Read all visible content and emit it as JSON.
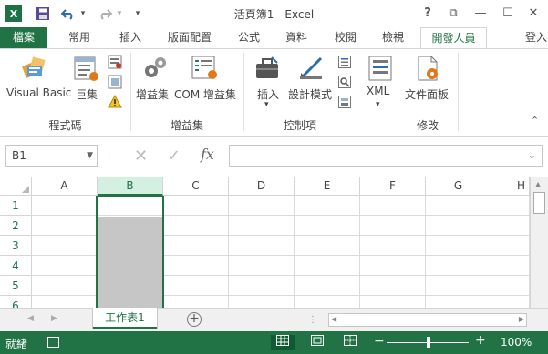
{
  "app": {
    "title": "活頁簿1 - Excel",
    "logo_letter": "X",
    "colors": {
      "accent": "#217346",
      "status_bar": "#217346",
      "selection": "#c6c6c6",
      "header_highlight": "#d3f0e0"
    }
  },
  "quick_access": {
    "icons": [
      "save-icon",
      "undo-icon",
      "undo-dropdown-icon",
      "redo-icon",
      "redo-dropdown-icon",
      "customize-qat-icon"
    ]
  },
  "window_controls": {
    "help": "?",
    "restore_ribbon": "⧉",
    "minimize": "—",
    "maximize": "☐",
    "close": "✕"
  },
  "tabs": [
    {
      "label": "檔案",
      "active": false,
      "file": true
    },
    {
      "label": "常用",
      "active": false
    },
    {
      "label": "插入",
      "active": false
    },
    {
      "label": "版面配置",
      "active": false
    },
    {
      "label": "公式",
      "active": false
    },
    {
      "label": "資料",
      "active": false
    },
    {
      "label": "校閱",
      "active": false
    },
    {
      "label": "檢視",
      "active": false
    },
    {
      "label": "開發人員",
      "active": true
    }
  ],
  "login_label": "登入",
  "ribbon": {
    "groups": [
      {
        "label": "程式碼",
        "items": [
          "Visual Basic",
          "巨集"
        ]
      },
      {
        "label": "增益集",
        "items": [
          "增益集",
          "COM 增益集"
        ]
      },
      {
        "label": "控制項",
        "items": [
          "插入",
          "設計模式"
        ]
      },
      {
        "label": "XML",
        "items": [
          "XML"
        ]
      },
      {
        "label": "修改",
        "items": [
          "文件面板"
        ]
      }
    ],
    "insert_dropdown": "▾",
    "xml_dropdown": "▾"
  },
  "formula_bar": {
    "name_box": "B1",
    "cancel_icon": "✕",
    "enter_icon": "✓",
    "fx_label": "fx",
    "value": ""
  },
  "grid": {
    "columns": [
      "A",
      "B",
      "C",
      "D",
      "E",
      "F",
      "G",
      "H"
    ],
    "rows": [
      "1",
      "2",
      "3",
      "4",
      "5",
      "6"
    ],
    "selected_column": "B",
    "active_cell": "B1"
  },
  "sheets": {
    "tabs": [
      "工作表1"
    ],
    "active": "工作表1",
    "add_label": "+"
  },
  "status_bar": {
    "ready_text": "就緒",
    "zoom_minus": "−",
    "zoom_plus": "+",
    "zoom_level": "100%",
    "zoom_fraction": 0.5
  }
}
